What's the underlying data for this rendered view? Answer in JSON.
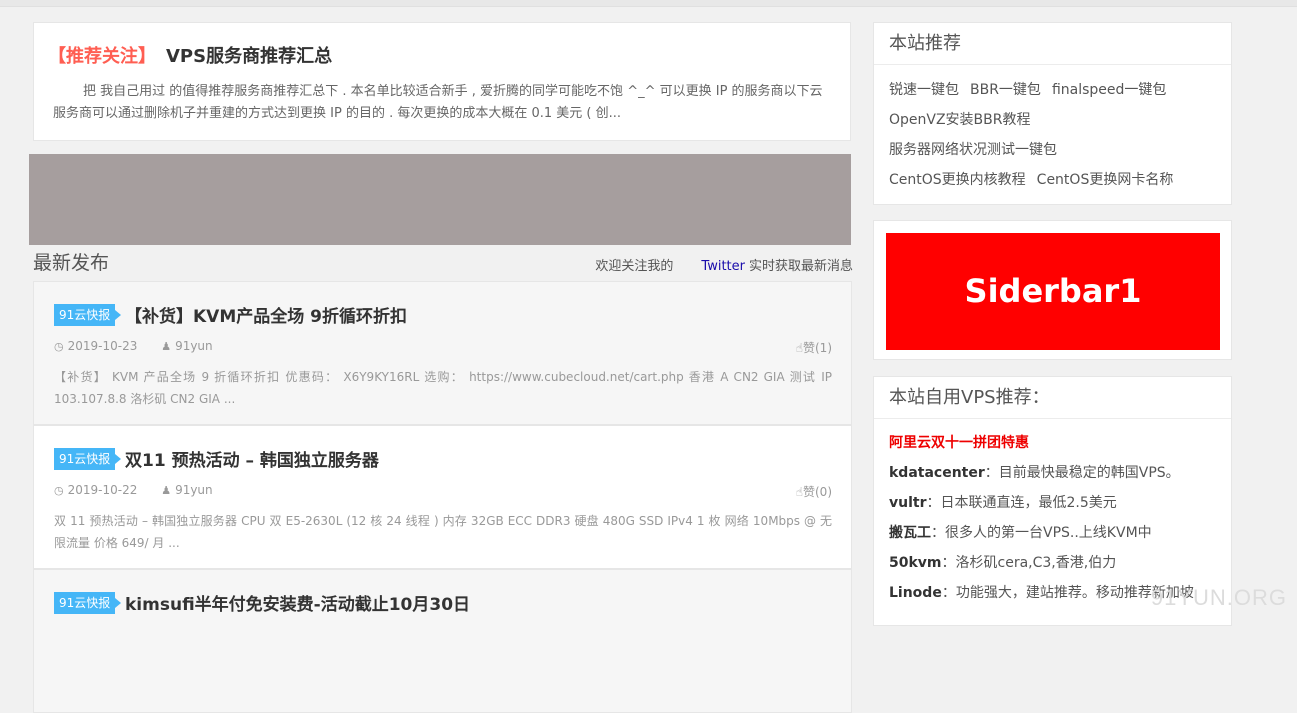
{
  "sticky": {
    "tag": "【推荐关注】",
    "title": "VPS服务商推荐汇总",
    "excerpt": "把 我自己用过 的值得推荐服务商推荐汇总下 . 本名单比较适合新手 , 爱折腾的同学可能吃不饱 ^_^ 可以更换 IP 的服务商以下云服务商可以通过删除机子并重建的方式达到更换 IP 的目的 . 每次更换的成本大概在 0.1 美元 ( 创..."
  },
  "section": {
    "title": "最新发布",
    "note_before": "欢迎关注我的",
    "twitter": "Twitter",
    "note_after": "实时获取最新消息"
  },
  "posts": [
    {
      "category": "91云快报",
      "title": "【补货】KVM产品全场 9折循环折扣",
      "date": "2019-10-23",
      "author": "91yun",
      "likes": "赞(1)",
      "excerpt": "【补货】 KVM 产品全场 9 折循环折扣 优惠码： X6Y9KY16RL 选购： https://www.cubecloud.net/cart.php 香港 A CN2 GIA 测试 IP 103.107.8.8 洛杉矶 CN2 GIA ..."
    },
    {
      "category": "91云快报",
      "title": "双11 预热活动 – 韩国独立服务器",
      "date": "2019-10-22",
      "author": "91yun",
      "likes": "赞(0)",
      "excerpt": "双 11 预热活动 – 韩国独立服务器 CPU 双 E5-2630L (12 核 24 线程 ) 内存 32GB ECC DDR3 硬盘 480G SSD IPv4 1 枚 网络 10Mbps @ 无限流量 价格 649/ 月 ..."
    },
    {
      "category": "91云快报",
      "title": "kimsufi半年付免安装费-活动截止10月30日",
      "date": "",
      "author": "",
      "likes": "",
      "excerpt": ""
    }
  ],
  "sidebar": {
    "recommend": {
      "title": "本站推荐",
      "rows": [
        [
          "锐速一键包",
          "BBR一键包",
          "finalspeed一键包"
        ],
        [
          "OpenVZ安装BBR教程"
        ],
        [
          "服务器网络状况测试一键包"
        ],
        [
          "CentOS更换内核教程",
          "CentOS更换网卡名称"
        ]
      ]
    },
    "ad_text": "Siderbar1",
    "vps": {
      "title": "本站自用VPS推荐：",
      "hot": "阿里云双十一拼团特惠",
      "items": [
        {
          "name": "kdatacenter",
          "desc": "：目前最快最稳定的韩国VPS。"
        },
        {
          "name": "vultr",
          "desc": "：日本联通直连，最低2.5美元"
        },
        {
          "name": "搬瓦工",
          "desc": "：很多人的第一台VPS..上线KVM中"
        },
        {
          "name": "50kvm",
          "desc": "：洛杉矶cera,C3,香港,伯力"
        },
        {
          "name": "Linode",
          "desc": "：功能强大，建站推荐。移动推荐新加坡"
        }
      ]
    }
  },
  "watermark": "91YUN.ORG"
}
